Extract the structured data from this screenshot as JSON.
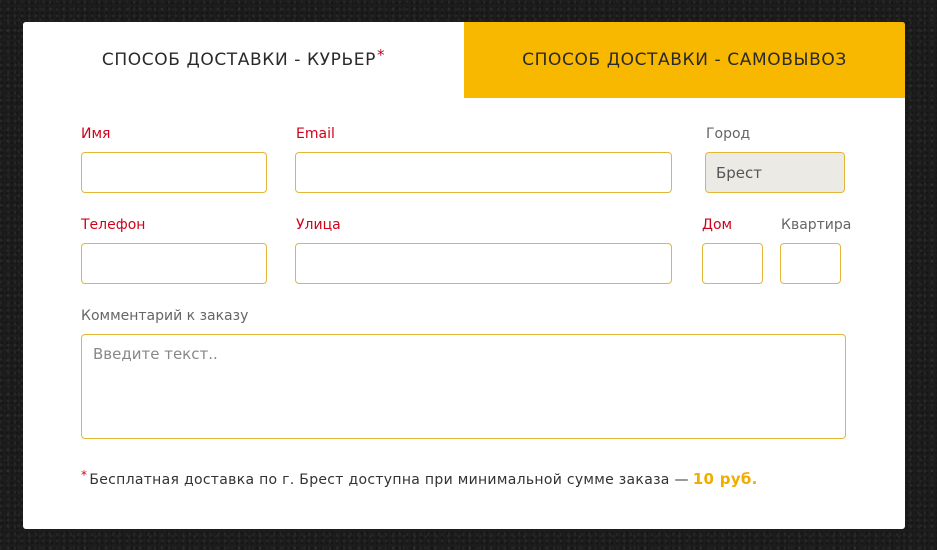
{
  "tabs": {
    "courier_label": "СПОСОБ ДОСТАВКИ - КУРЬЕР",
    "courier_marker": "*",
    "pickup_label": "СПОСОБ ДОСТАВКИ - САМОВЫВОЗ"
  },
  "form": {
    "name_label": "Имя",
    "email_label": "Email",
    "city_label": "Город",
    "city_value": "Брест",
    "phone_label": "Телефон",
    "street_label": "Улица",
    "house_label": "Дом",
    "apartment_label": "Квартира",
    "comment_label": "Комментарий к заказу",
    "comment_placeholder": "Введите текст.."
  },
  "note": {
    "marker": "*",
    "text": "Бесплатная доставка по г. Брест доступна при минимальной сумме заказа —",
    "price": "10 руб."
  },
  "colors": {
    "accent": "#f9b800",
    "required": "#d0021b",
    "input_border": "#e3b63a",
    "price": "#f0ad00"
  }
}
